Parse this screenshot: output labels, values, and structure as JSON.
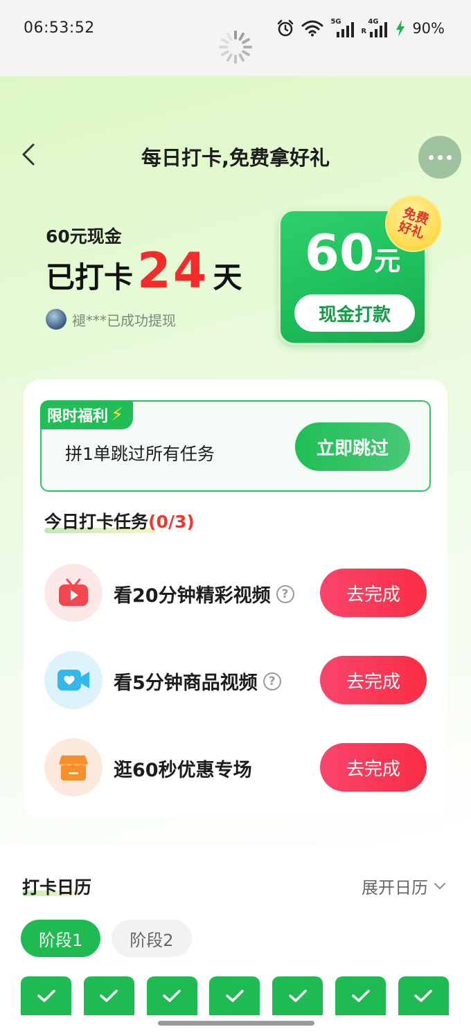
{
  "status_bar": {
    "time": "06:53:52",
    "battery": "90%",
    "network_1": "5G",
    "network_2": "4G"
  },
  "nav": {
    "title": "每日打卡,免费拿好礼"
  },
  "reward": {
    "subtitle": "60元现金",
    "checked_prefix": "已打卡",
    "days": "24",
    "checked_suffix": "天",
    "winner_text": "褪***已成功提现"
  },
  "cash_card": {
    "amount": "60",
    "unit": "元",
    "button": "现金打款",
    "badge_line1": "免费",
    "badge_line2": "好礼"
  },
  "promo": {
    "tag": "限时福利",
    "text": "拼1单跳过所有任务",
    "button": "立即跳过"
  },
  "tasks": {
    "title": "今日打卡任务",
    "count": "(0/3)",
    "items": [
      {
        "label": "看20分钟精彩视频",
        "help": "?",
        "button": "去完成",
        "icon": "tv-icon"
      },
      {
        "label": "看5分钟商品视频",
        "help": "?",
        "button": "去完成",
        "icon": "video-camera-icon"
      },
      {
        "label": "逛60秒优惠专场",
        "button": "去完成",
        "icon": "store-icon"
      }
    ]
  },
  "calendar": {
    "title": "打卡日历",
    "expand": "展开日历",
    "phases": [
      "阶段1",
      "阶段2"
    ],
    "checked_days": 7
  },
  "colors": {
    "brand_green": "#1fbb52",
    "accent_red": "#f32b2b",
    "task_button": "#fb2d44"
  }
}
